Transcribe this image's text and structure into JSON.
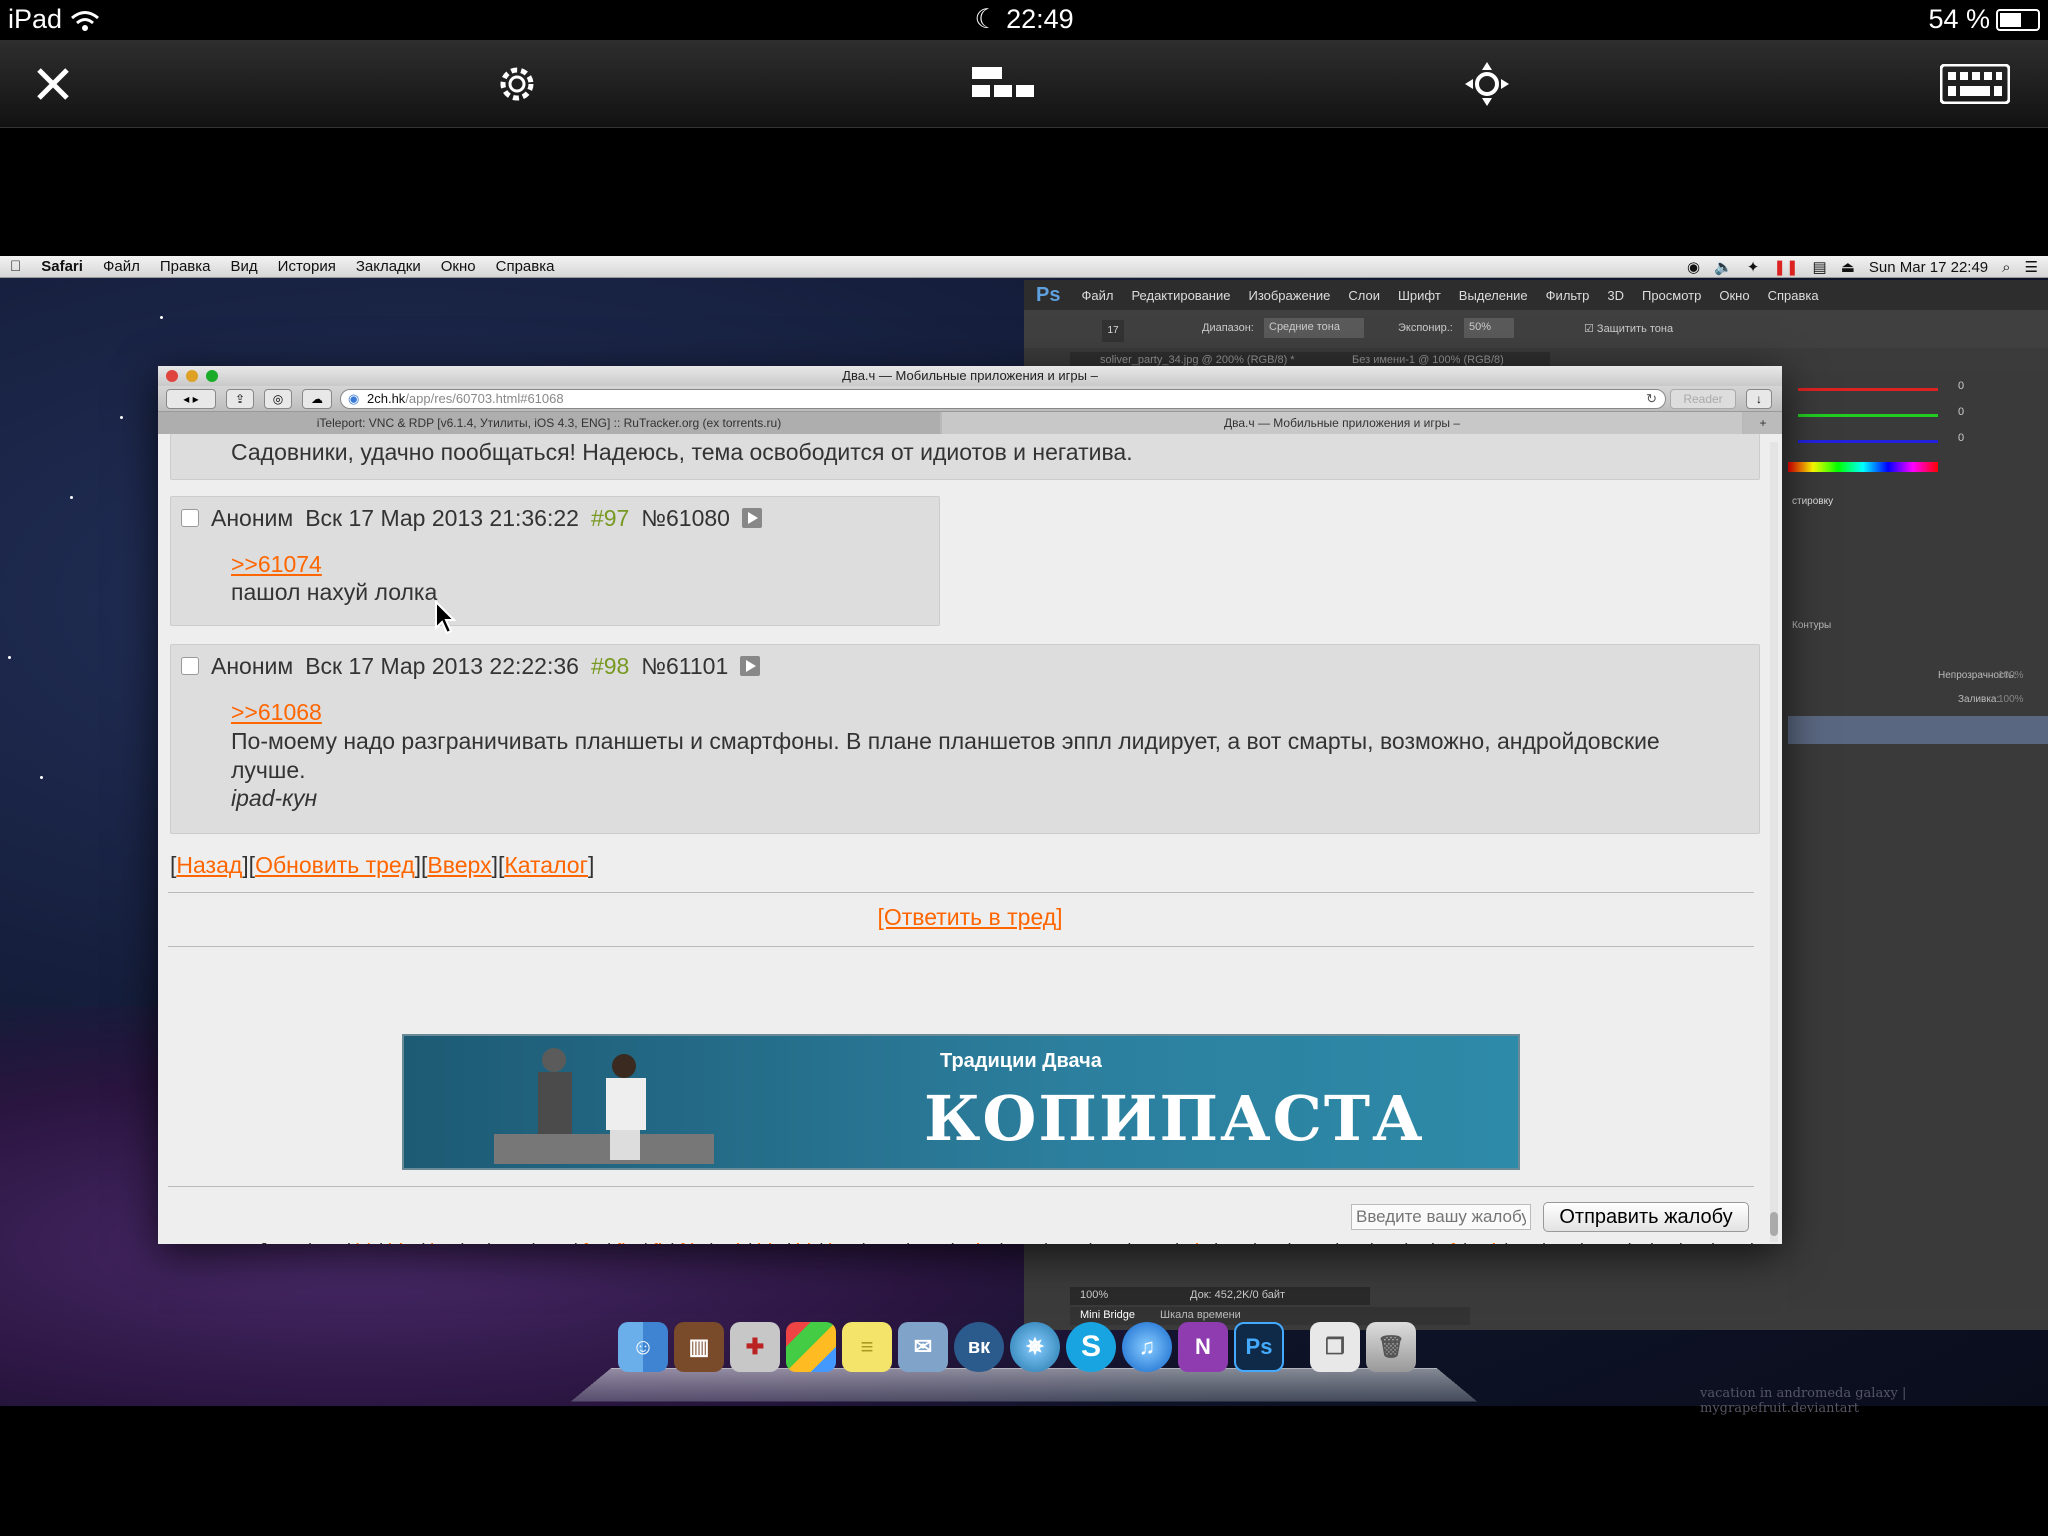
{
  "ios": {
    "device": "iPad",
    "time": "22:49",
    "battery": "54 %"
  },
  "mac_menu": {
    "app": "Safari",
    "items": [
      "Файл",
      "Правка",
      "Вид",
      "История",
      "Закладки",
      "Окно",
      "Справка"
    ],
    "clock": "Sun Mar 17  22:49"
  },
  "ps": {
    "menu": [
      "Файл",
      "Редактирование",
      "Изображение",
      "Слои",
      "Шрифт",
      "Выделение",
      "Фильтр",
      "3D",
      "Просмотр",
      "Окно",
      "Справка"
    ],
    "opt_range_label": "Диапазон:",
    "opt_range_value": "Средние тона",
    "opt_exposure_label": "Экспонир.:",
    "opt_exposure_value": "50%",
    "opt_protect": "Защитить тона",
    "brush_size": "17",
    "tab1": "soliver_party_34.jpg @ 200% (RGB/8) *",
    "tab2": "Без имени-1 @ 100% (RGB/8)",
    "rgb_values": [
      "0",
      "0",
      "0"
    ],
    "panel_adjust": "стировку",
    "panel_paths": "Контуры",
    "opacity_label": "Непрозрачность:",
    "opacity_value": "100%",
    "fill_label": "Заливка:",
    "fill_value": "100%",
    "zoom": "100%",
    "doc": "Док: 452,2K/0 байт",
    "tab_minibridge": "Mini Bridge",
    "tab_timeline": "Шкала времени"
  },
  "safari": {
    "title": "Два.ч — Мобильные приложения и игры –",
    "url_host": "2ch.hk",
    "url_path": "/app/res/60703.html#61068",
    "reader": "Reader",
    "tab1": "iTeleport: VNC & RDP [v6.1.4, Утилиты, iOS 4.3, ENG] :: RuTracker.org (ex torrents.ru)",
    "tab2": "Два.ч — Мобильные приложения и игры –"
  },
  "page": {
    "prev_post_text": "Садовники, удачно пообщаться! Надеюсь, тема освободится от идиотов и негатива.",
    "posts": [
      {
        "name": "Аноним",
        "date": "Вск 17 Мар 2013 21:36:22",
        "num": "#97",
        "id": "№61080",
        "reply": ">>61074",
        "text": "пашол нахуй лолка",
        "sign": ""
      },
      {
        "name": "Аноним",
        "date": "Вск 17 Мар 2013 22:22:36",
        "num": "#98",
        "id": "№61101",
        "reply": ">>61068",
        "text": "По-моему надо разграничивать планшеты и смартфоны. В плане планшетов эппл лидирует, а вот смарты, возможно, андройдовские лучше.",
        "sign": "ipad-кун"
      }
    ],
    "nav": [
      "Назад",
      "Обновить тред",
      "Вверх",
      "Каталог"
    ],
    "reply_link": "[Ответить в тред]",
    "banner_top": "Традиции Двача",
    "banner_big": "КОПИПАСТА",
    "complaint_placeholder": "Введите вашу жалобу",
    "complaint_button": "Отправить жалобу",
    "topics_label": "Тематика",
    "topics": [
      "app",
      "au",
      "bi",
      "biz",
      "bo",
      "c",
      "em",
      "ew",
      "fa",
      "fiz",
      "fl",
      "ftb",
      "gd",
      "hh",
      "hi",
      "hw",
      "me",
      "mg",
      "mlp",
      "mo",
      "mu",
      "ne",
      "pvc",
      "ph",
      "po",
      "pr",
      "psy",
      "ra",
      "re",
      "s",
      "sf",
      "sci",
      "sn",
      "sp",
      "spc",
      "t",
      "tr",
      "tv",
      "un",
      "w",
      "web",
      "wh",
      "wm",
      "chat"
    ]
  },
  "dock": {
    "apps": [
      "finder-icon",
      "books-icon",
      "preview-icon",
      "finder-windows-icon",
      "stickies-icon",
      "mail-icon",
      "vk-icon",
      "safari-icon",
      "skype-icon",
      "itunes-icon",
      "onenote-icon",
      "photoshop-icon",
      "documents-icon",
      "trash-icon"
    ],
    "vk": "вк",
    "skype": "S",
    "onenote": "N",
    "ps": "Ps"
  },
  "credit": "vacation in andromeda galaxy | mygrapefruit.deviantart",
  "colors": {
    "link": "#ff6600",
    "post_num": "#789922",
    "post_bg": "#dddddd",
    "page_bg": "#eeeeee"
  }
}
